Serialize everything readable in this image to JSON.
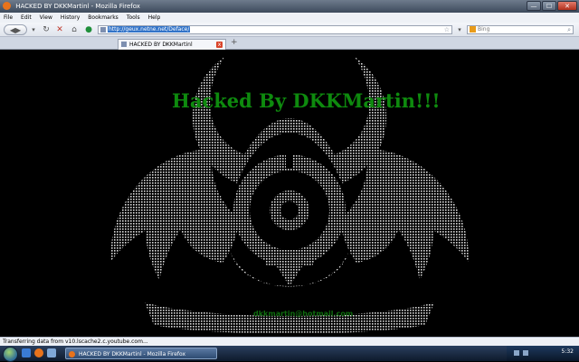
{
  "window": {
    "title": "HACKED BY DKKMartinl - Mozilla Firefox",
    "controls": [
      "—",
      "☐",
      "✕"
    ]
  },
  "menu": [
    "File",
    "Edit",
    "View",
    "History",
    "Bookmarks",
    "Tools",
    "Help"
  ],
  "navbar": {
    "url": "http://geux.netne.net/Deface/",
    "search_placeholder": "Bing"
  },
  "tab": {
    "label": "HACKED BY DKKMartinl",
    "new_tab": "+"
  },
  "page": {
    "headline": "Hacked By DKKMartin!!!",
    "email": "dkkmartin@hotmail.com",
    "art_color": "#d8d8d8",
    "headline_color": "#0e8a0e"
  },
  "statusbar": {
    "text": "Transferring data from v10.lscache2.c.youtube.com..."
  },
  "taskbar": {
    "task_label": "HACKED BY DKKMartinl - Mozilla Firefox",
    "clock": "5:32"
  }
}
